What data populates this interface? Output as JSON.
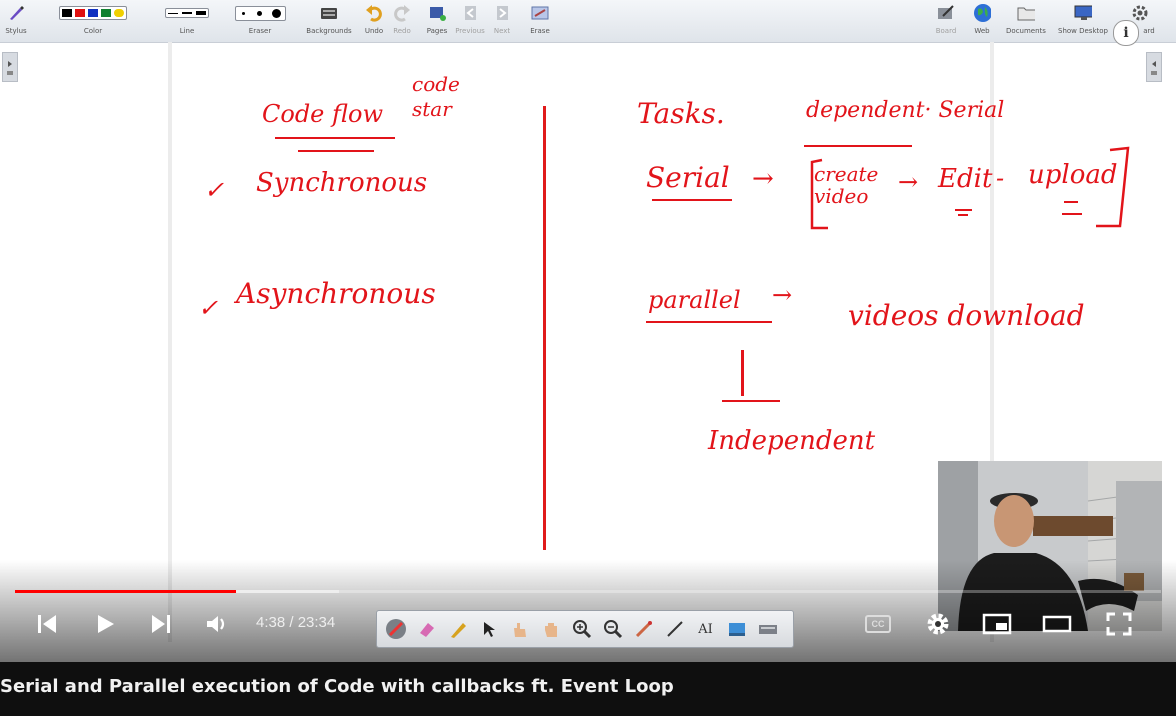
{
  "toolbar": {
    "stylus_label": "Stylus",
    "color_label": "Color",
    "line_label": "Line",
    "eraser_label": "Eraser",
    "backgrounds_label": "Backgrounds",
    "undo_label": "Undo",
    "redo_label": "Redo",
    "pages_label": "Pages",
    "previous_label": "Previous",
    "next_label": "Next",
    "erase_label": "Erase",
    "board_label": "Board",
    "web_label": "Web",
    "documents_label": "Documents",
    "show_desktop_label": "Show Desktop",
    "keyboard_label": "ard",
    "colors": [
      "#000000",
      "#e01010",
      "#1030c0",
      "#108030",
      "#f0d000"
    ]
  },
  "board": {
    "left": {
      "code_flow": "Code flow",
      "code_start": "code\nstar",
      "synchronous": "Synchronous",
      "asynchronous": "Asynchronous",
      "check_marks": [
        "✓",
        "✓"
      ]
    },
    "right": {
      "tasks": "Tasks.",
      "dependent_serial": "dependent· Serial",
      "serial": "Serial",
      "arrow": "→",
      "create_video": "create\nvideo",
      "edit": "Edit",
      "upload": "upload",
      "parallel": "parallel",
      "videos_download": "videos download",
      "independent": "Independent"
    },
    "ink_color": "#e2141a"
  },
  "player": {
    "time_display": "4:38 / 23:34",
    "progress_fraction": 0.193,
    "buffered_fraction": 0.283,
    "video_title": "Serial and Parallel execution of Code with callbacks ft. Event Loop",
    "cc_label": "CC",
    "pen_tool_text": "AI"
  }
}
